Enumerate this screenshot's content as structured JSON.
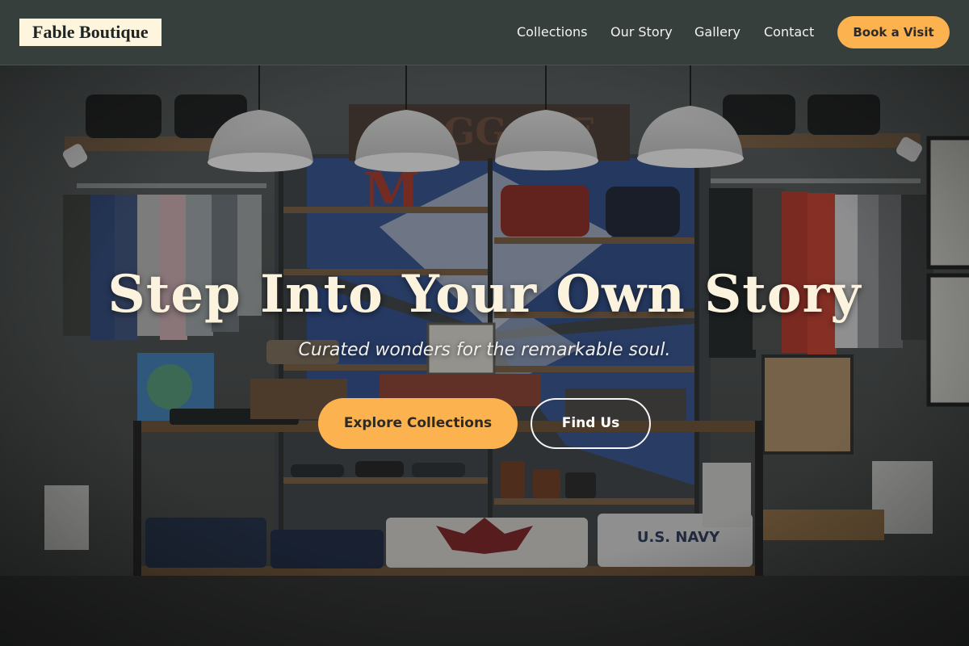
{
  "brand": {
    "name": "Fable Boutique"
  },
  "nav": {
    "items": [
      {
        "label": "Collections"
      },
      {
        "label": "Our Story"
      },
      {
        "label": "Gallery"
      },
      {
        "label": "Contact"
      }
    ],
    "cta_label": "Book a Visit"
  },
  "hero": {
    "title": "Step Into Your Own Story",
    "tagline": "Curated wonders for the remarkable soul.",
    "primary_button": "Explore Collections",
    "secondary_button": "Find Us",
    "background": "boutique-interior-photo"
  },
  "colors": {
    "header_bg": "#373f3c",
    "accent": "#fbb24f",
    "logo_bg": "#fdf5dd",
    "title_text": "#fbf3de"
  }
}
